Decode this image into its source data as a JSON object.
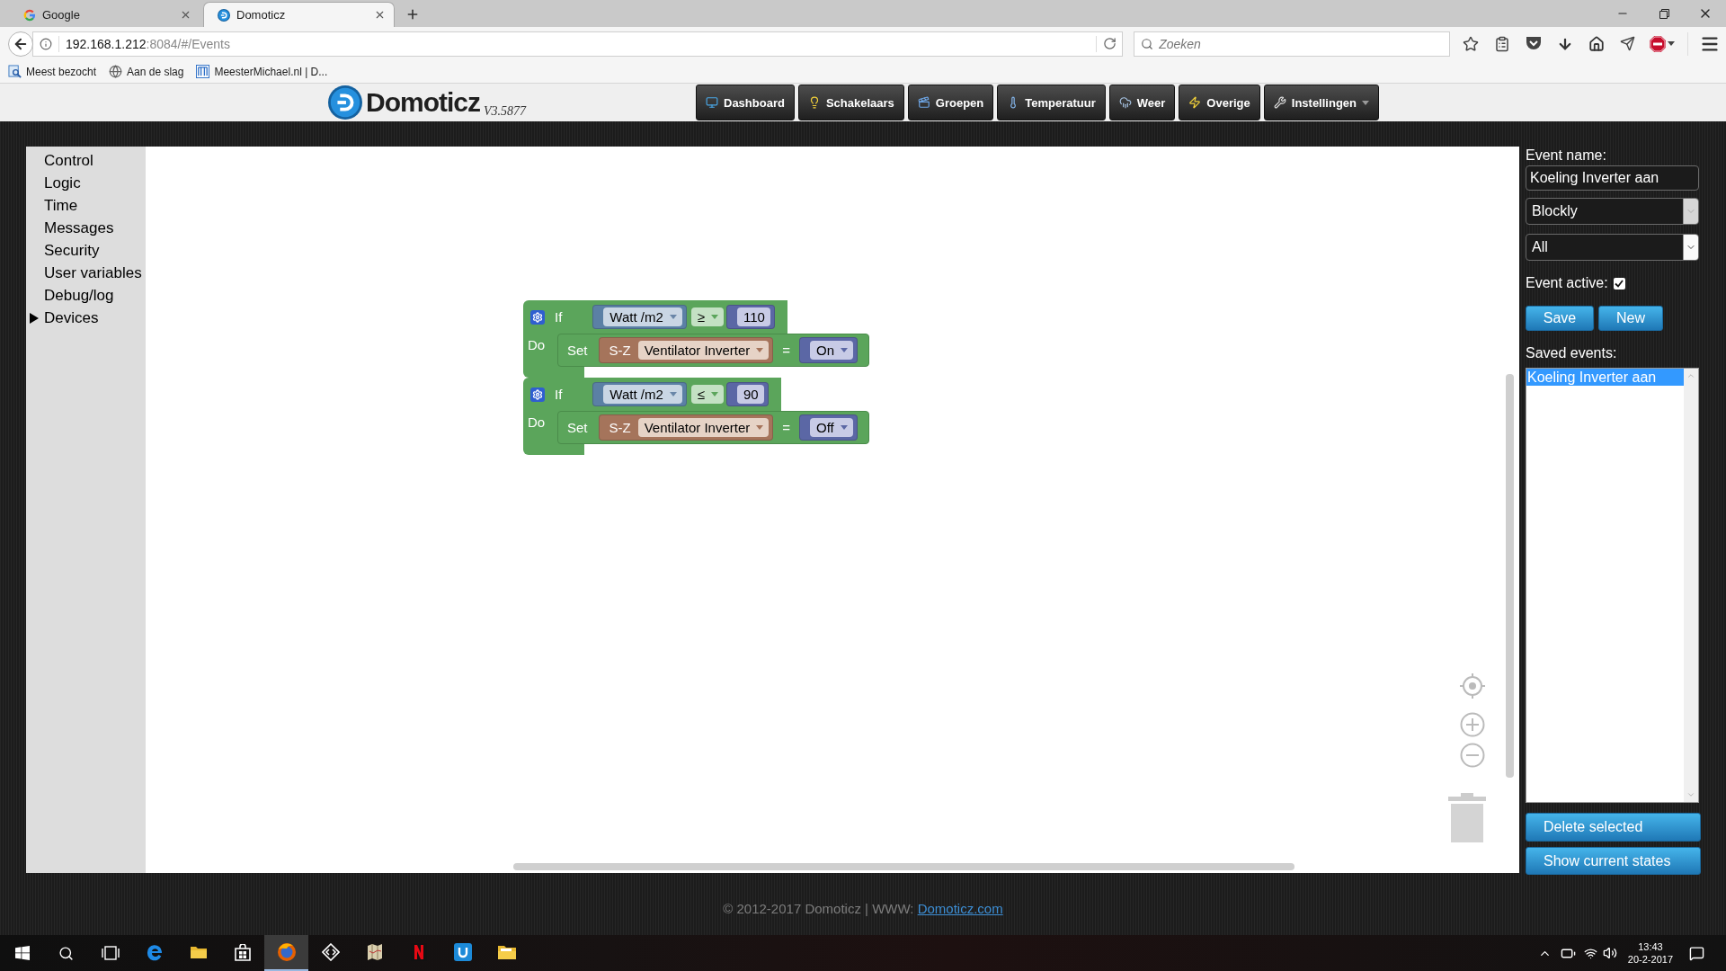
{
  "browser": {
    "tabs": [
      {
        "title": "Google",
        "selected": false
      },
      {
        "title": "Domoticz",
        "selected": true
      }
    ],
    "address": {
      "host": "192.168.1.212",
      "path": ":8084/#/Events"
    },
    "search": {
      "placeholder": "Zoeken"
    },
    "bookmarks": [
      {
        "label": "Meest bezocht"
      },
      {
        "label": "Aan de slag"
      },
      {
        "label": "MeesterMichael.nl | D..."
      }
    ]
  },
  "app": {
    "logo": {
      "name": "Domoticz",
      "version": "V3.5877"
    },
    "nav": [
      {
        "label": "Dashboard",
        "dropdown": false
      },
      {
        "label": "Schakelaars",
        "dropdown": false
      },
      {
        "label": "Groepen",
        "dropdown": false
      },
      {
        "label": "Temperatuur",
        "dropdown": false
      },
      {
        "label": "Weer",
        "dropdown": false
      },
      {
        "label": "Overige",
        "dropdown": false
      },
      {
        "label": "Instellingen",
        "dropdown": true
      }
    ]
  },
  "toolbox": [
    {
      "label": "Control",
      "kind": "category"
    },
    {
      "label": "Logic",
      "kind": "category"
    },
    {
      "label": "Time",
      "kind": "category"
    },
    {
      "label": "Messages",
      "kind": "category"
    },
    {
      "label": "Security",
      "kind": "category"
    },
    {
      "label": "User variables",
      "kind": "category"
    },
    {
      "label": "Debug/log",
      "kind": "category"
    },
    {
      "label": "Devices",
      "kind": "folder"
    }
  ],
  "blocks": [
    {
      "keyword": "If",
      "sensor": "Watt /m2",
      "operator": "≥",
      "threshold": "110",
      "do_label": "Do",
      "verb": "Set",
      "group": "S-Z",
      "device": "Ventilator Inverter",
      "equals": "=",
      "state": "On"
    },
    {
      "keyword": "If",
      "sensor": "Watt /m2",
      "operator": "≤",
      "threshold": "90",
      "do_label": "Do",
      "verb": "Set",
      "group": "S-Z",
      "device": "Ventilator Inverter",
      "equals": "=",
      "state": "Off"
    }
  ],
  "editor": {
    "name_label": "Event name:",
    "name": "Koeling Inverter aan",
    "selects": [
      {
        "value": "Blockly",
        "disabled": true
      },
      {
        "value": "All",
        "disabled": false
      }
    ],
    "active_label": "Event active:",
    "active": true,
    "buttons": [
      "Save",
      "New"
    ],
    "saved_label": "Saved events:",
    "saved_events": [
      {
        "name": "Koeling Inverter aan",
        "selected": true
      }
    ],
    "actions": [
      "Delete selected",
      "Show current states"
    ]
  },
  "footer": {
    "text": "© 2012-2017 Domoticz | WWW:",
    "link": "Domoticz.com"
  },
  "taskbar": {
    "apps": [
      {
        "active": false
      },
      {
        "active": false
      },
      {
        "active": false
      },
      {
        "active": true
      },
      {
        "active": false
      },
      {
        "active": false
      },
      {
        "active": false
      },
      {
        "active": false
      },
      {
        "active": false
      }
    ],
    "time": "13:43",
    "date": "20-2-2017"
  }
}
